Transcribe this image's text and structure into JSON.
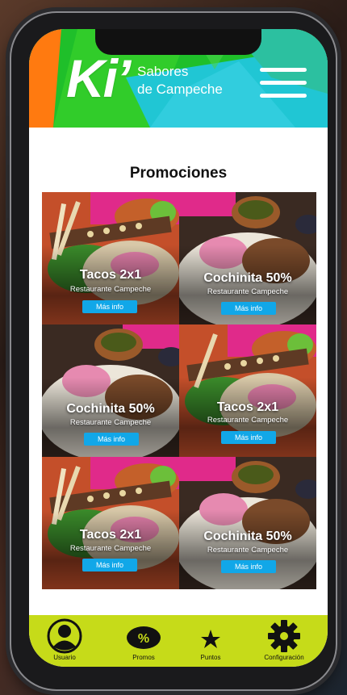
{
  "app": {
    "logo_text": "Ki’",
    "logo_sub_line1": "Sabores",
    "logo_sub_line2": "de Campeche"
  },
  "page": {
    "title": "Promociones"
  },
  "promos": [
    {
      "name": "Tacos 2x1",
      "restaurant": "Restaurante Campeche",
      "button": "Más info",
      "image": "tacos"
    },
    {
      "name": "Cochinita 50%",
      "restaurant": "Restaurante Campeche",
      "button": "Más info",
      "image": "cochinita"
    },
    {
      "name": "Cochinita 50%",
      "restaurant": "Restaurante Campeche",
      "button": "Más info",
      "image": "cochinita"
    },
    {
      "name": "Tacos 2x1",
      "restaurant": "Restaurante Campeche",
      "button": "Más info",
      "image": "tacos"
    },
    {
      "name": "Tacos 2x1",
      "restaurant": "Restaurante Campeche",
      "button": "Más info",
      "image": "tacos"
    },
    {
      "name": "Cochinita 50%",
      "restaurant": "Restaurante Campeche",
      "button": "Más info",
      "image": "cochinita"
    }
  ],
  "tabbar": {
    "items": [
      {
        "label": "Usuario",
        "icon": "user-icon"
      },
      {
        "label": "Promos",
        "icon": "percent-tag-icon"
      },
      {
        "label": "Puntos",
        "icon": "star-icon"
      },
      {
        "label": "Configuración",
        "icon": "gear-icon"
      }
    ]
  },
  "colors": {
    "header_green": "#1fbf2a",
    "header_cyan": "#21c6d6",
    "header_orange": "#ff7a10",
    "tabbar": "#c6db19",
    "button_blue": "#11a7e8"
  }
}
